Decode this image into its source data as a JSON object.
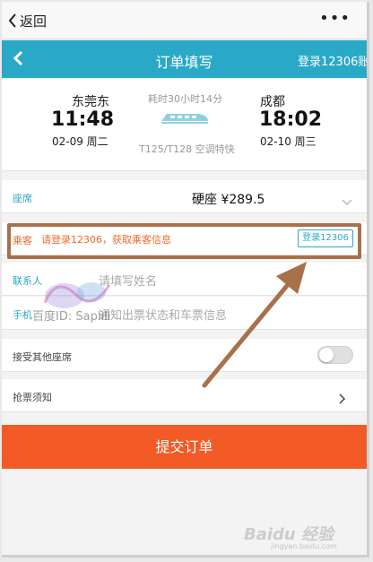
{
  "topbar": {
    "back_label": "返回",
    "more_label": "•••"
  },
  "header": {
    "title": "订单填写",
    "login_label": "登录12306账"
  },
  "train": {
    "from_station": "东莞东",
    "from_time": "11:48",
    "from_date": "02-09 周二",
    "duration": "耗时30小时14分",
    "train_no": "T125/T128 空调特快",
    "to_station": "成都",
    "to_time": "18:02",
    "to_date": "02-10 周三"
  },
  "seat": {
    "label": "座席",
    "value": "硬座 ¥289.5"
  },
  "passenger": {
    "label": "乘客",
    "tip": "请登录12306，获取乘客信息",
    "login_button": "登录12306"
  },
  "contact": {
    "label": "联系人",
    "placeholder": "请填写姓名"
  },
  "phone": {
    "label": "手机",
    "placeholder": "通知出票状态和车票信息"
  },
  "accept_other": {
    "label": "接受其他座席",
    "enabled": false
  },
  "notice": {
    "label": "抢票须知"
  },
  "submit": {
    "label": "提交订单"
  },
  "watermark": {
    "text": "百度ID: Saplili"
  },
  "baidu_logo": {
    "text": "Baidu 经验",
    "sub": "jingyan.baidu.com"
  },
  "colors": {
    "brand": "#2aa9c7",
    "submit": "#f25a26",
    "highlight": "#a9704a",
    "warning_text": "#ef6a2a"
  }
}
